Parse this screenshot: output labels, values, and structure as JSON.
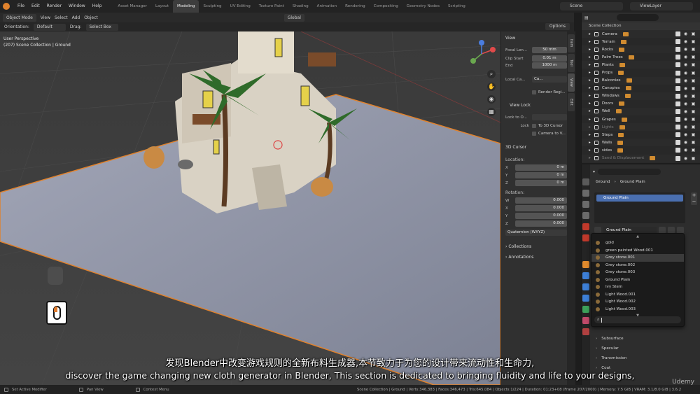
{
  "top_menu": {
    "items": [
      "File",
      "Edit",
      "Render",
      "Window",
      "Help"
    ],
    "workspaces": [
      "Asset Manager",
      "Layout",
      "Modeling",
      "Sculpting",
      "UV Editing",
      "Texture Paint",
      "Shading",
      "Animation",
      "Rendering",
      "Compositing",
      "Geometry Nodes",
      "Scripting"
    ],
    "active_workspace": "Modeling",
    "scene": "Scene",
    "view_layer": "ViewLayer"
  },
  "viewport_header": {
    "mode": "Object Mode",
    "menus": [
      "View",
      "Select",
      "Add",
      "Object"
    ],
    "transform": "Global",
    "orientation_label": "Orientation:",
    "orientation_value": "Default",
    "drag_label": "Drag:",
    "drag_value": "Select Box",
    "options": "Options"
  },
  "viewport": {
    "view_name": "User Perspective",
    "collection_info": "(207) Scene Collection | Ground"
  },
  "npanel": {
    "view_section": "View",
    "focal_length_label": "Focal Len...",
    "focal_length": "50 mm",
    "clip_start_label": "Clip Start",
    "clip_start": "0.01 m",
    "end_label": "End",
    "end": "1000 m",
    "local_camera_label": "Local Ca...",
    "local_camera_value": "Ca...",
    "render_region": "Render Regi...",
    "view_lock_section": "View Lock",
    "lock_to_object_label": "Lock to O...",
    "lock_label": "Lock",
    "to_3d_cursor": "To 3D Cursor",
    "camera_to_view": "Camera to V...",
    "cursor_section": "3D Cursor",
    "location_label": "Location:",
    "loc": [
      {
        "axis": "X",
        "value": "0 m"
      },
      {
        "axis": "Y",
        "value": "0 m"
      },
      {
        "axis": "Z",
        "value": "0 m"
      }
    ],
    "rotation_label": "Rotation:",
    "rot": [
      {
        "axis": "W",
        "value": "0.000"
      },
      {
        "axis": "X",
        "value": "0.000"
      },
      {
        "axis": "Y",
        "value": "0.000"
      },
      {
        "axis": "Z",
        "value": "0.000"
      }
    ],
    "rotation_mode": "Quaternion (WXYZ)",
    "collections": "Collections",
    "annotations": "Annotations",
    "tabs": [
      "Item",
      "Tool",
      "View",
      "Edit"
    ]
  },
  "outliner": {
    "root": "Scene Collection",
    "items": [
      {
        "name": "Camera",
        "dim": false
      },
      {
        "name": "Terrain",
        "dim": false
      },
      {
        "name": "Rocks",
        "dim": false
      },
      {
        "name": "Palm Trees",
        "dim": false
      },
      {
        "name": "Plants",
        "dim": false
      },
      {
        "name": "Props",
        "dim": false
      },
      {
        "name": "Balconies",
        "dim": false
      },
      {
        "name": "Canopies",
        "dim": false
      },
      {
        "name": "Windows",
        "dim": false
      },
      {
        "name": "Doors",
        "dim": false
      },
      {
        "name": "Well",
        "dim": false
      },
      {
        "name": "Grapes",
        "dim": false
      },
      {
        "name": "Lights",
        "dim": true
      },
      {
        "name": "Steps",
        "dim": false
      },
      {
        "name": "Walls",
        "dim": false
      },
      {
        "name": "sides",
        "dim": false
      },
      {
        "name": "Sand & Displacement",
        "dim": true
      }
    ]
  },
  "properties": {
    "breadcrumb_object": "Ground",
    "breadcrumb_material": "Ground Plain",
    "slot": "Ground Plain",
    "material_name": "Ground Plain",
    "materials": [
      "gold",
      "green painted Wood.001",
      "Grey stone.001",
      "Grey stone.002",
      "Grey stone.003",
      "Ground Plain",
      "Ivy Stem",
      "Light Wood.001",
      "Light Wood.002",
      "Light Wood.003"
    ],
    "highlighted_material": "Grey stone.001",
    "sections": [
      "Subsurface",
      "Specular",
      "Transmission",
      "Coat"
    ]
  },
  "statusbar": {
    "set_active_modifier": "Set Active Modifier",
    "pan_view": "Pan View",
    "context_menu": "Context Menu",
    "info": "Scene Collection | Ground | Verts:346,383 | Faces:346,473 | Tris:645,084 | Objects:1/224 | Duration: 01:23+08 (Frame 207/2000) | Memory: 7.5 GiB | VRAM: 3.1/8.0 GiB | 3.6.2"
  },
  "subtitles": {
    "zh": "发现Blender中改变游戏规则的全新布料生成器,本节致力于为您的设计带来流动性和生命力,",
    "en": "discover the game changing new cloth generator in Blender, This section is dedicated to bringing fluidity and life to your designs,"
  },
  "watermark": "Udemy",
  "colors": {
    "accent_orange": "#e0822d",
    "selection_blue": "#4a6fb0",
    "ground_plane": "#8f95a8"
  }
}
